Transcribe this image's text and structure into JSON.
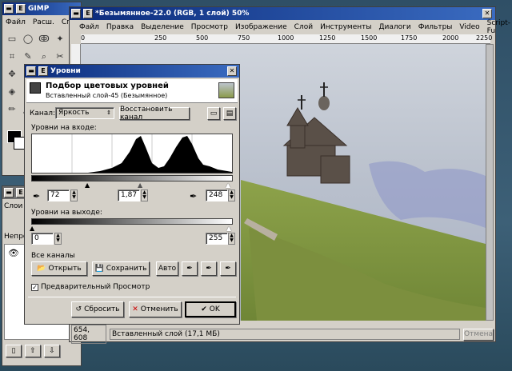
{
  "toolbox": {
    "title": "GIMP",
    "menu": [
      "Файл",
      "Расш.",
      "Справка"
    ]
  },
  "layers_window": {
    "labels": [
      "Слои",
      "Непроз"
    ]
  },
  "image_window": {
    "title": "*Безымянное-22.0 (RGB, 1 слой) 50%",
    "menu": [
      "Файл",
      "Правка",
      "Выделение",
      "Просмотр",
      "Изображение",
      "Слой",
      "Инструменты",
      "Диалоги",
      "Фильтры",
      "Video",
      "Script-Fu"
    ],
    "ruler_marks": [
      "0",
      "250",
      "500",
      "750",
      "1000",
      "1250",
      "1500",
      "1750",
      "2000",
      "2250"
    ],
    "status": {
      "coords": "654, 608",
      "layer_info": "Вставленный слой (17,1 МБ)",
      "cancel": "Отмена"
    }
  },
  "levels_dialog": {
    "title": "Уровни",
    "header_title": "Подбор цветовых уровней",
    "header_subtitle": "Вставленный слой-45 (Безымянное)",
    "channel_label": "Канал:",
    "channel_value": "Яркость",
    "reset_channel": "Восстановить канал",
    "input_levels_label": "Уровни на входе:",
    "input_low": "72",
    "input_gamma": "1,87",
    "input_high": "248",
    "output_levels_label": "Уровни на выходе:",
    "output_low": "0",
    "output_high": "255",
    "all_channels_label": "Все каналы",
    "open": "Открыть",
    "save": "Сохранить",
    "auto": "Авто",
    "preview_label": "Предварительный Просмотр",
    "reset": "Сбросить",
    "cancel": "Отменить",
    "ok": "OK"
  }
}
